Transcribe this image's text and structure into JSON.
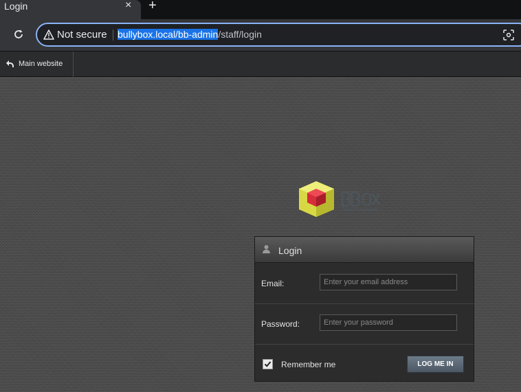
{
  "browser": {
    "tab_title": "Login",
    "tab_close": "×",
    "new_tab": "+",
    "security_label": "Not secure",
    "url_host": "bullybox.local/bb-admin",
    "url_path": "/staff/login"
  },
  "adminbar": {
    "main_website_label": "Main website"
  },
  "login": {
    "title": "Login",
    "email_label": "Email:",
    "email_placeholder": "Enter your email address",
    "password_label": "Password:",
    "password_placeholder": "Enter your password",
    "remember_label": "Remember me",
    "remember_checked": true,
    "submit_label": "LOG ME IN"
  },
  "colors": {
    "focus_ring": "#8ab4f8",
    "url_selection": "#1a73e8",
    "button": "#5b6674",
    "logo_outer": "#d8d845",
    "logo_inner": "#d62d3a"
  },
  "icons": [
    "reload-icon",
    "warning-icon",
    "lens-icon",
    "back-arrow-icon",
    "user-icon",
    "checkmark-icon",
    "bbox-logo"
  ]
}
